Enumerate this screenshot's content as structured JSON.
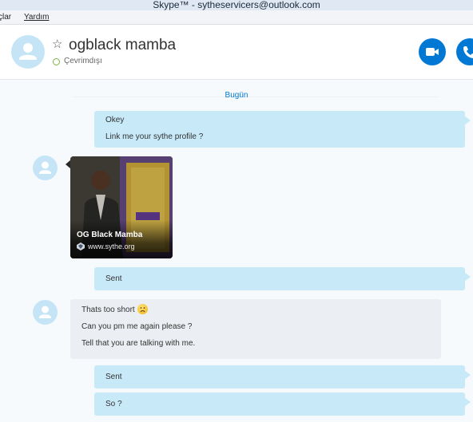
{
  "window": {
    "title": "Skype™ - sytheservicers@outlook.com"
  },
  "menu": {
    "items": [
      "çlar",
      "Yardım"
    ]
  },
  "header": {
    "contact_name": "ogblack mamba",
    "status": "Çevrimdışı"
  },
  "chat": {
    "date_separator": "Bugün",
    "messages": [
      {
        "direction": "out",
        "lines": [
          "Okey",
          "Link me your sythe profile ?"
        ]
      },
      {
        "direction": "in",
        "type": "link-preview",
        "title": "OG Black Mamba",
        "site": "www.sythe.org"
      },
      {
        "direction": "out",
        "lines": [
          "Sent"
        ]
      },
      {
        "direction": "in",
        "lines": [
          "Thats too short",
          "Can you pm me again please ?",
          "Tell that you are talking with me."
        ],
        "emoji": "sad-face-icon"
      },
      {
        "direction": "out",
        "lines": [
          "Sent"
        ]
      },
      {
        "direction": "out",
        "lines": [
          "So ?"
        ]
      }
    ]
  },
  "colors": {
    "accent": "#0078d4",
    "outgoing_bubble": "#c7e9f8",
    "incoming_bubble": "#ebeef2",
    "status_offline": "#7cb342",
    "avatar_bg": "#c5e5f6"
  },
  "icons": {
    "favorite": "star-outline-icon",
    "video_call": "video-camera-icon",
    "audio_call": "phone-icon",
    "avatar": "default-person-icon"
  }
}
